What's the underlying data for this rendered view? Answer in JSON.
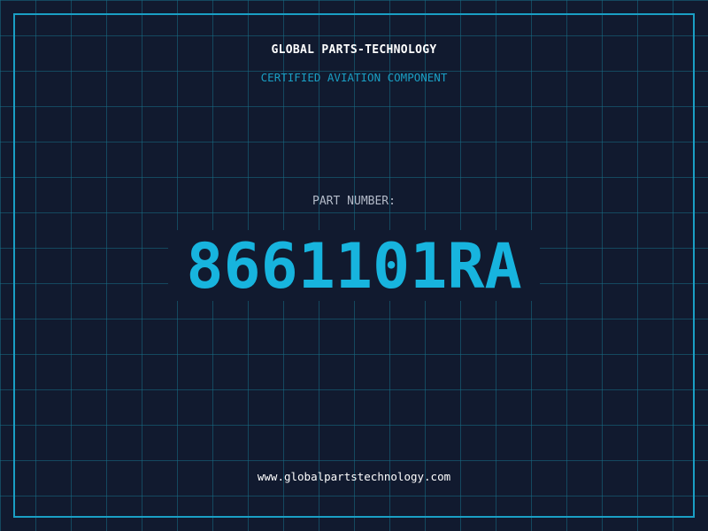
{
  "header": {
    "company": "GLOBAL PARTS-TECHNOLOGY",
    "tagline": "CERTIFIED AVIATION COMPONENT"
  },
  "part": {
    "label": "PART NUMBER:",
    "number": "8661101RA"
  },
  "footer": {
    "website": "www.globalpartstechnology.com"
  },
  "colors": {
    "background": "#111a2f",
    "grid": "#166e87",
    "accent": "#1a9fc4",
    "part_number": "#17b4de",
    "label": "#b3bac8",
    "text": "#ffffff"
  }
}
